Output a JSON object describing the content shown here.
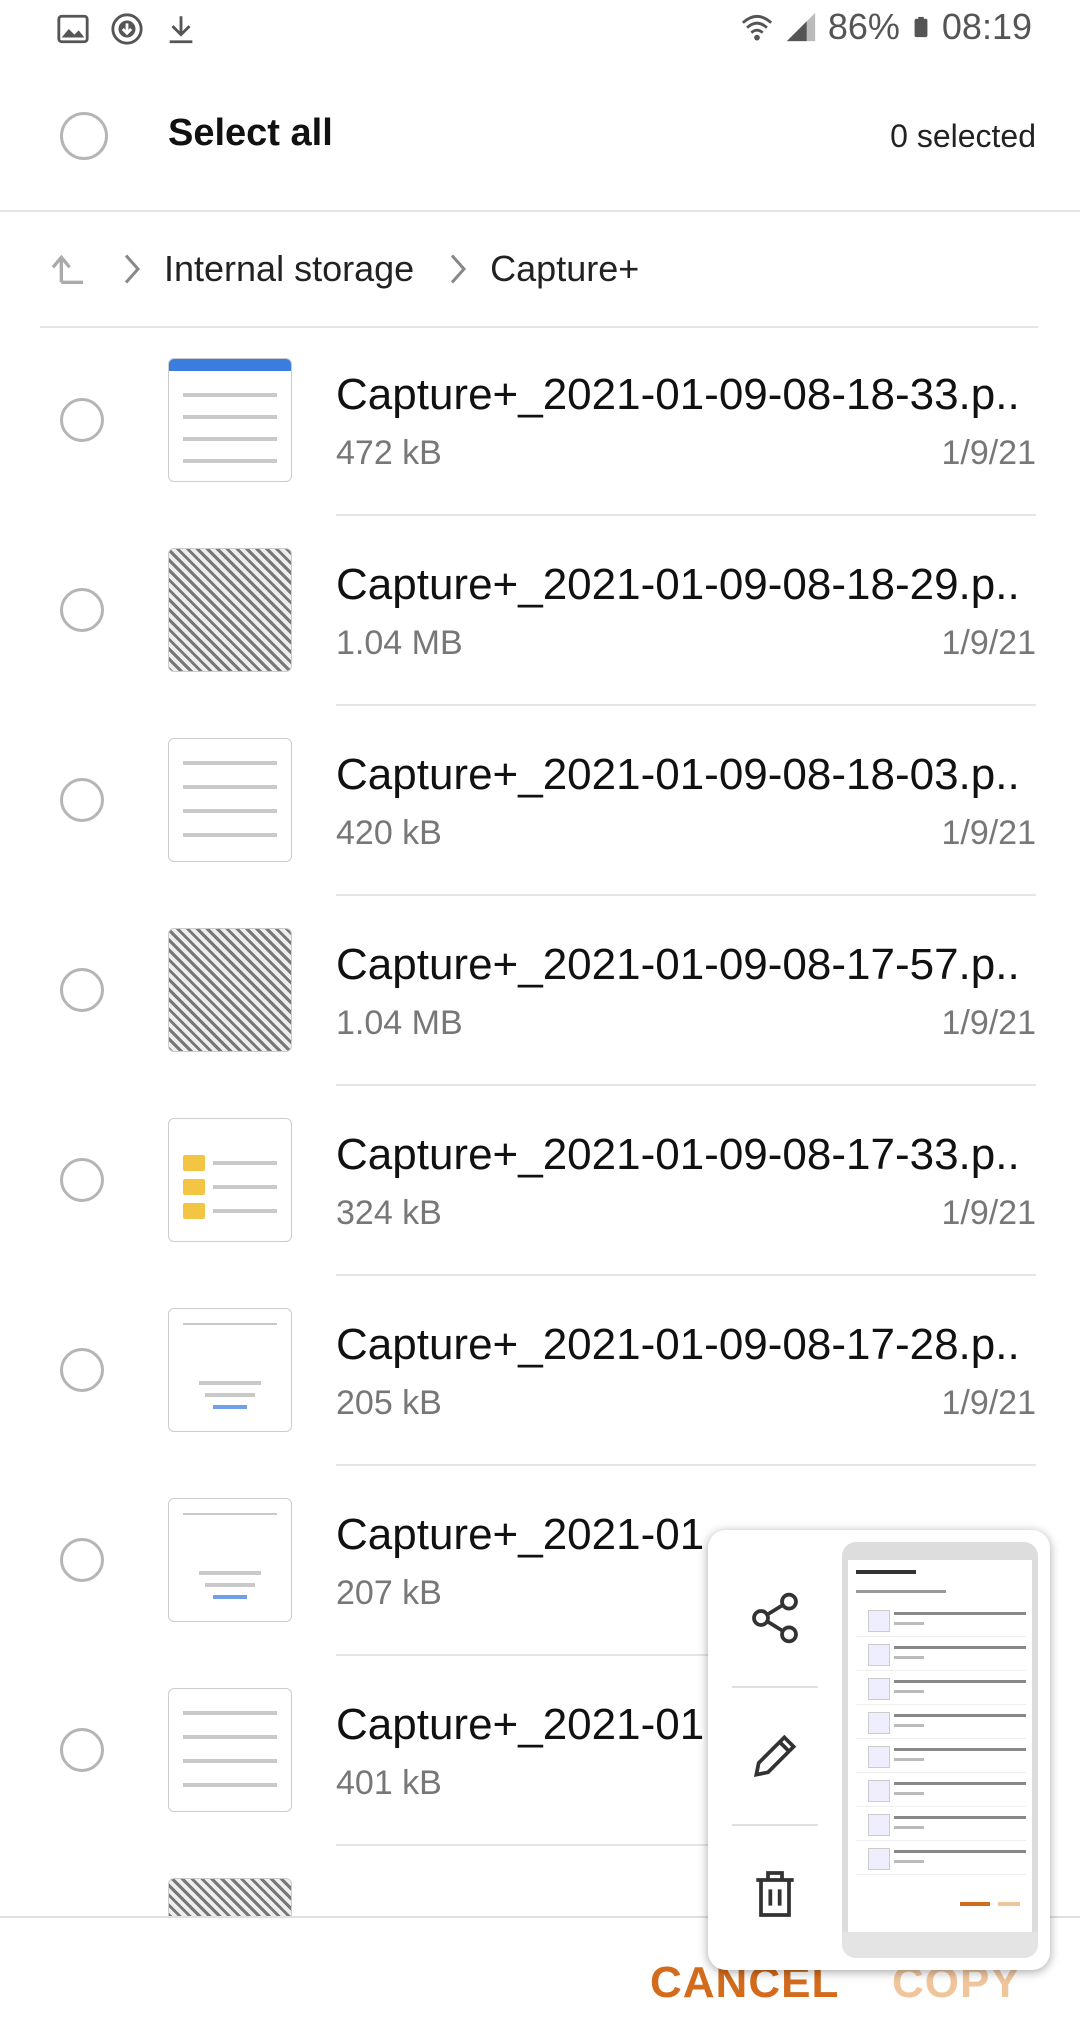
{
  "status": {
    "battery": "86%",
    "time": "08:19"
  },
  "header": {
    "select_all": "Select all",
    "count": "0 selected"
  },
  "breadcrumb": {
    "root": "Internal storage",
    "current": "Capture+"
  },
  "files": [
    {
      "name": "Capture+_2021-01-09-08-18-33.p..",
      "size": "472 kB",
      "date": "1/9/21",
      "thumb": "list"
    },
    {
      "name": "Capture+_2021-01-09-08-18-29.p..",
      "size": "1.04 MB",
      "date": "1/9/21",
      "thumb": "qr"
    },
    {
      "name": "Capture+_2021-01-09-08-18-03.p..",
      "size": "420 kB",
      "date": "1/9/21",
      "thumb": "list"
    },
    {
      "name": "Capture+_2021-01-09-08-17-57.p..",
      "size": "1.04 MB",
      "date": "1/9/21",
      "thumb": "qr"
    },
    {
      "name": "Capture+_2021-01-09-08-17-33.p..",
      "size": "324 kB",
      "date": "1/9/21",
      "thumb": "folder"
    },
    {
      "name": "Capture+_2021-01-09-08-17-28.p..",
      "size": "205 kB",
      "date": "1/9/21",
      "thumb": "drop"
    },
    {
      "name": "Capture+_2021-01",
      "size": "207 kB",
      "date": "",
      "thumb": "drop"
    },
    {
      "name": "Capture+_2021-01",
      "size": "401 kB",
      "date": "",
      "thumb": "list"
    }
  ],
  "bottom": {
    "cancel": "CANCEL",
    "copy": "COPY"
  },
  "popup": {
    "actions": [
      "share-icon",
      "edit-icon",
      "delete-icon"
    ]
  },
  "colors": {
    "accent": "#d36b1c",
    "disabled": "#f0c59b"
  }
}
